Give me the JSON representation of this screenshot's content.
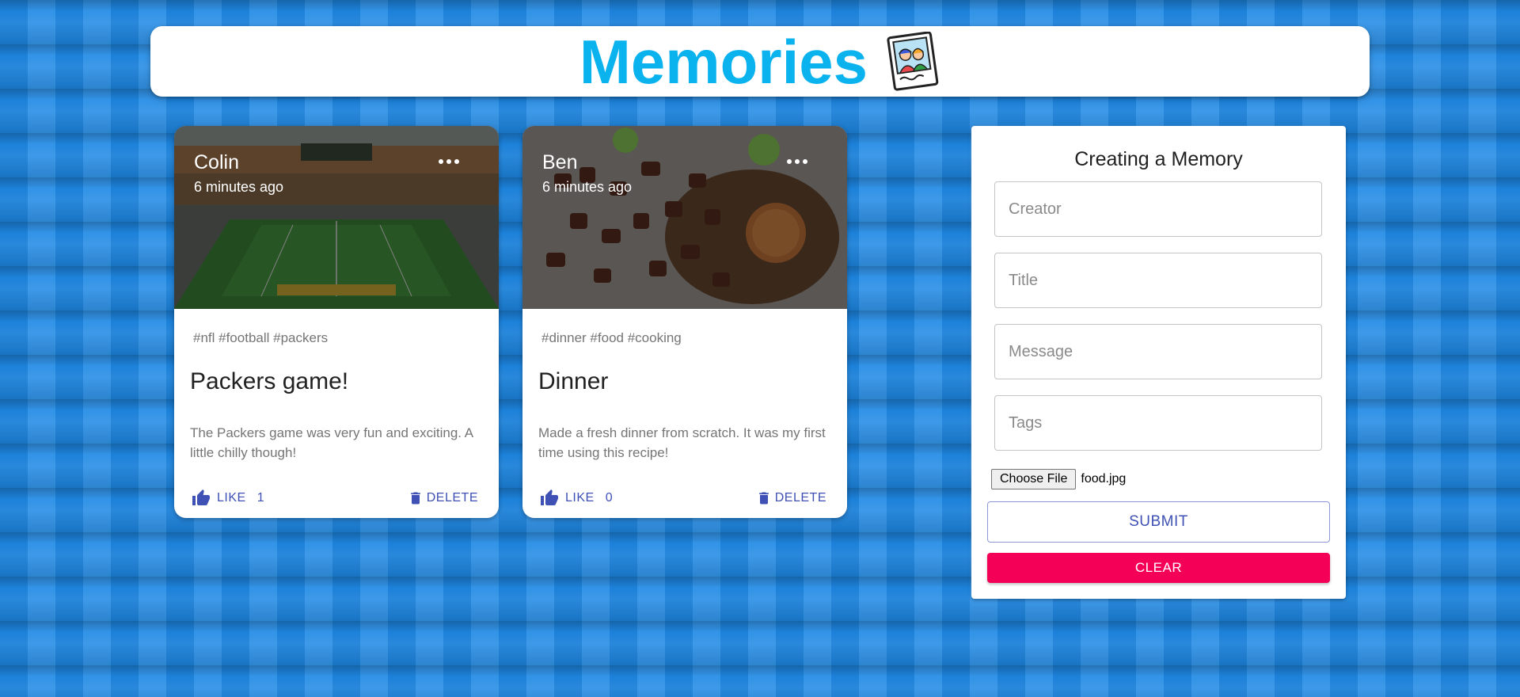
{
  "header": {
    "title": "Memories",
    "logo_icon": "memories-photo-icon"
  },
  "posts": [
    {
      "creator": "Colin",
      "time": "6 minutes ago",
      "tags": "#nfl #football #packers",
      "title": "Packers game!",
      "message": "The Packers game was very fun and exciting. A little chilly though!",
      "like_label": "LIKE",
      "like_count": "1",
      "delete_label": "DELETE"
    },
    {
      "creator": "Ben",
      "time": "6 minutes ago",
      "tags": "#dinner #food #cooking",
      "title": "Dinner",
      "message": "Made a fresh dinner from scratch. It was my first time using this recipe!",
      "like_label": "LIKE",
      "like_count": "0",
      "delete_label": "DELETE"
    }
  ],
  "form": {
    "title": "Creating a Memory",
    "creator_placeholder": "Creator",
    "title_placeholder": "Title",
    "message_placeholder": "Message",
    "tags_placeholder": "Tags",
    "choose_file_label": "Choose File",
    "file_name": "food.jpg",
    "submit_label": "SUBMIT",
    "clear_label": "CLEAR"
  },
  "colors": {
    "title": "#0ab2ee",
    "primary": "#3f51b5",
    "secondary": "#f50057",
    "background": "#1e88e5"
  }
}
